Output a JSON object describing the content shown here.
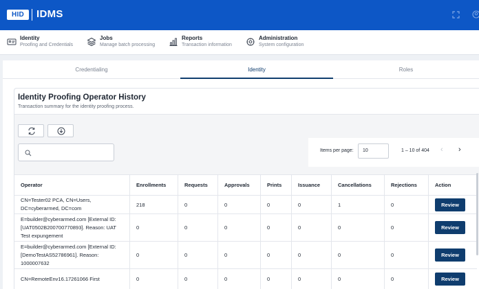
{
  "header": {
    "logo_text": "HID",
    "app_name": "IDMS",
    "icons": [
      "fullscreen-icon",
      "user-icon"
    ]
  },
  "nav": [
    {
      "title": "Identity",
      "subtitle": "Proofing and Credentials",
      "icon": "id-card-icon"
    },
    {
      "title": "Jobs",
      "subtitle": "Manage batch processing",
      "icon": "layers-icon"
    },
    {
      "title": "Reports",
      "subtitle": "Transaction information",
      "icon": "bar-chart-icon"
    },
    {
      "title": "Administration",
      "subtitle": "System configuration",
      "icon": "gear-icon"
    }
  ],
  "tabs": [
    {
      "label": "Credentialing",
      "active": false
    },
    {
      "label": "Identity",
      "active": true
    },
    {
      "label": "Roles",
      "active": false
    }
  ],
  "card": {
    "title": "Identity Proofing Operator History",
    "subtitle": "Transaction summary for the identity proofing process."
  },
  "toolbar": {
    "refresh_icon": "refresh-icon",
    "download_icon": "download-icon",
    "search_placeholder": ""
  },
  "pagination": {
    "items_per_page_label": "Items per page:",
    "items_per_page_value": "10",
    "range_text": "1 – 10 of 404"
  },
  "table": {
    "columns": [
      "Operator",
      "Enrollments",
      "Requests",
      "Approvals",
      "Prints",
      "Issuance",
      "Cancellations",
      "Rejections",
      "Action"
    ],
    "rows": [
      {
        "operator": "CN=Tester02 PCA, CN=Users, DC=cyberarmed, DC=com",
        "enrollments": "218",
        "requests": "0",
        "approvals": "0",
        "prints": "0",
        "issuance": "0",
        "cancellations": "1",
        "rejections": "0",
        "action": "Review"
      },
      {
        "operator": "E=builder@cyberarmed.com [External ID: [UAT0502B200700770893]. Reason: UAT Test expungement",
        "enrollments": "0",
        "requests": "0",
        "approvals": "0",
        "prints": "0",
        "issuance": "0",
        "cancellations": "0",
        "rejections": "0",
        "action": "Review"
      },
      {
        "operator": "E=builder@cyberarmed.com [External ID: [DemoTestAS52786961]. Reason: 1000007632",
        "enrollments": "0",
        "requests": "0",
        "approvals": "0",
        "prints": "0",
        "issuance": "0",
        "cancellations": "0",
        "rejections": "0",
        "action": "Review"
      },
      {
        "operator": "CN=RemoteEnv16.17261066 First",
        "enrollments": "0",
        "requests": "0",
        "approvals": "0",
        "prints": "0",
        "issuance": "0",
        "cancellations": "0",
        "rejections": "0",
        "action": "Review"
      }
    ]
  },
  "colors": {
    "header_blue": "#0d57c6",
    "primary_button": "#0f3d6e"
  }
}
